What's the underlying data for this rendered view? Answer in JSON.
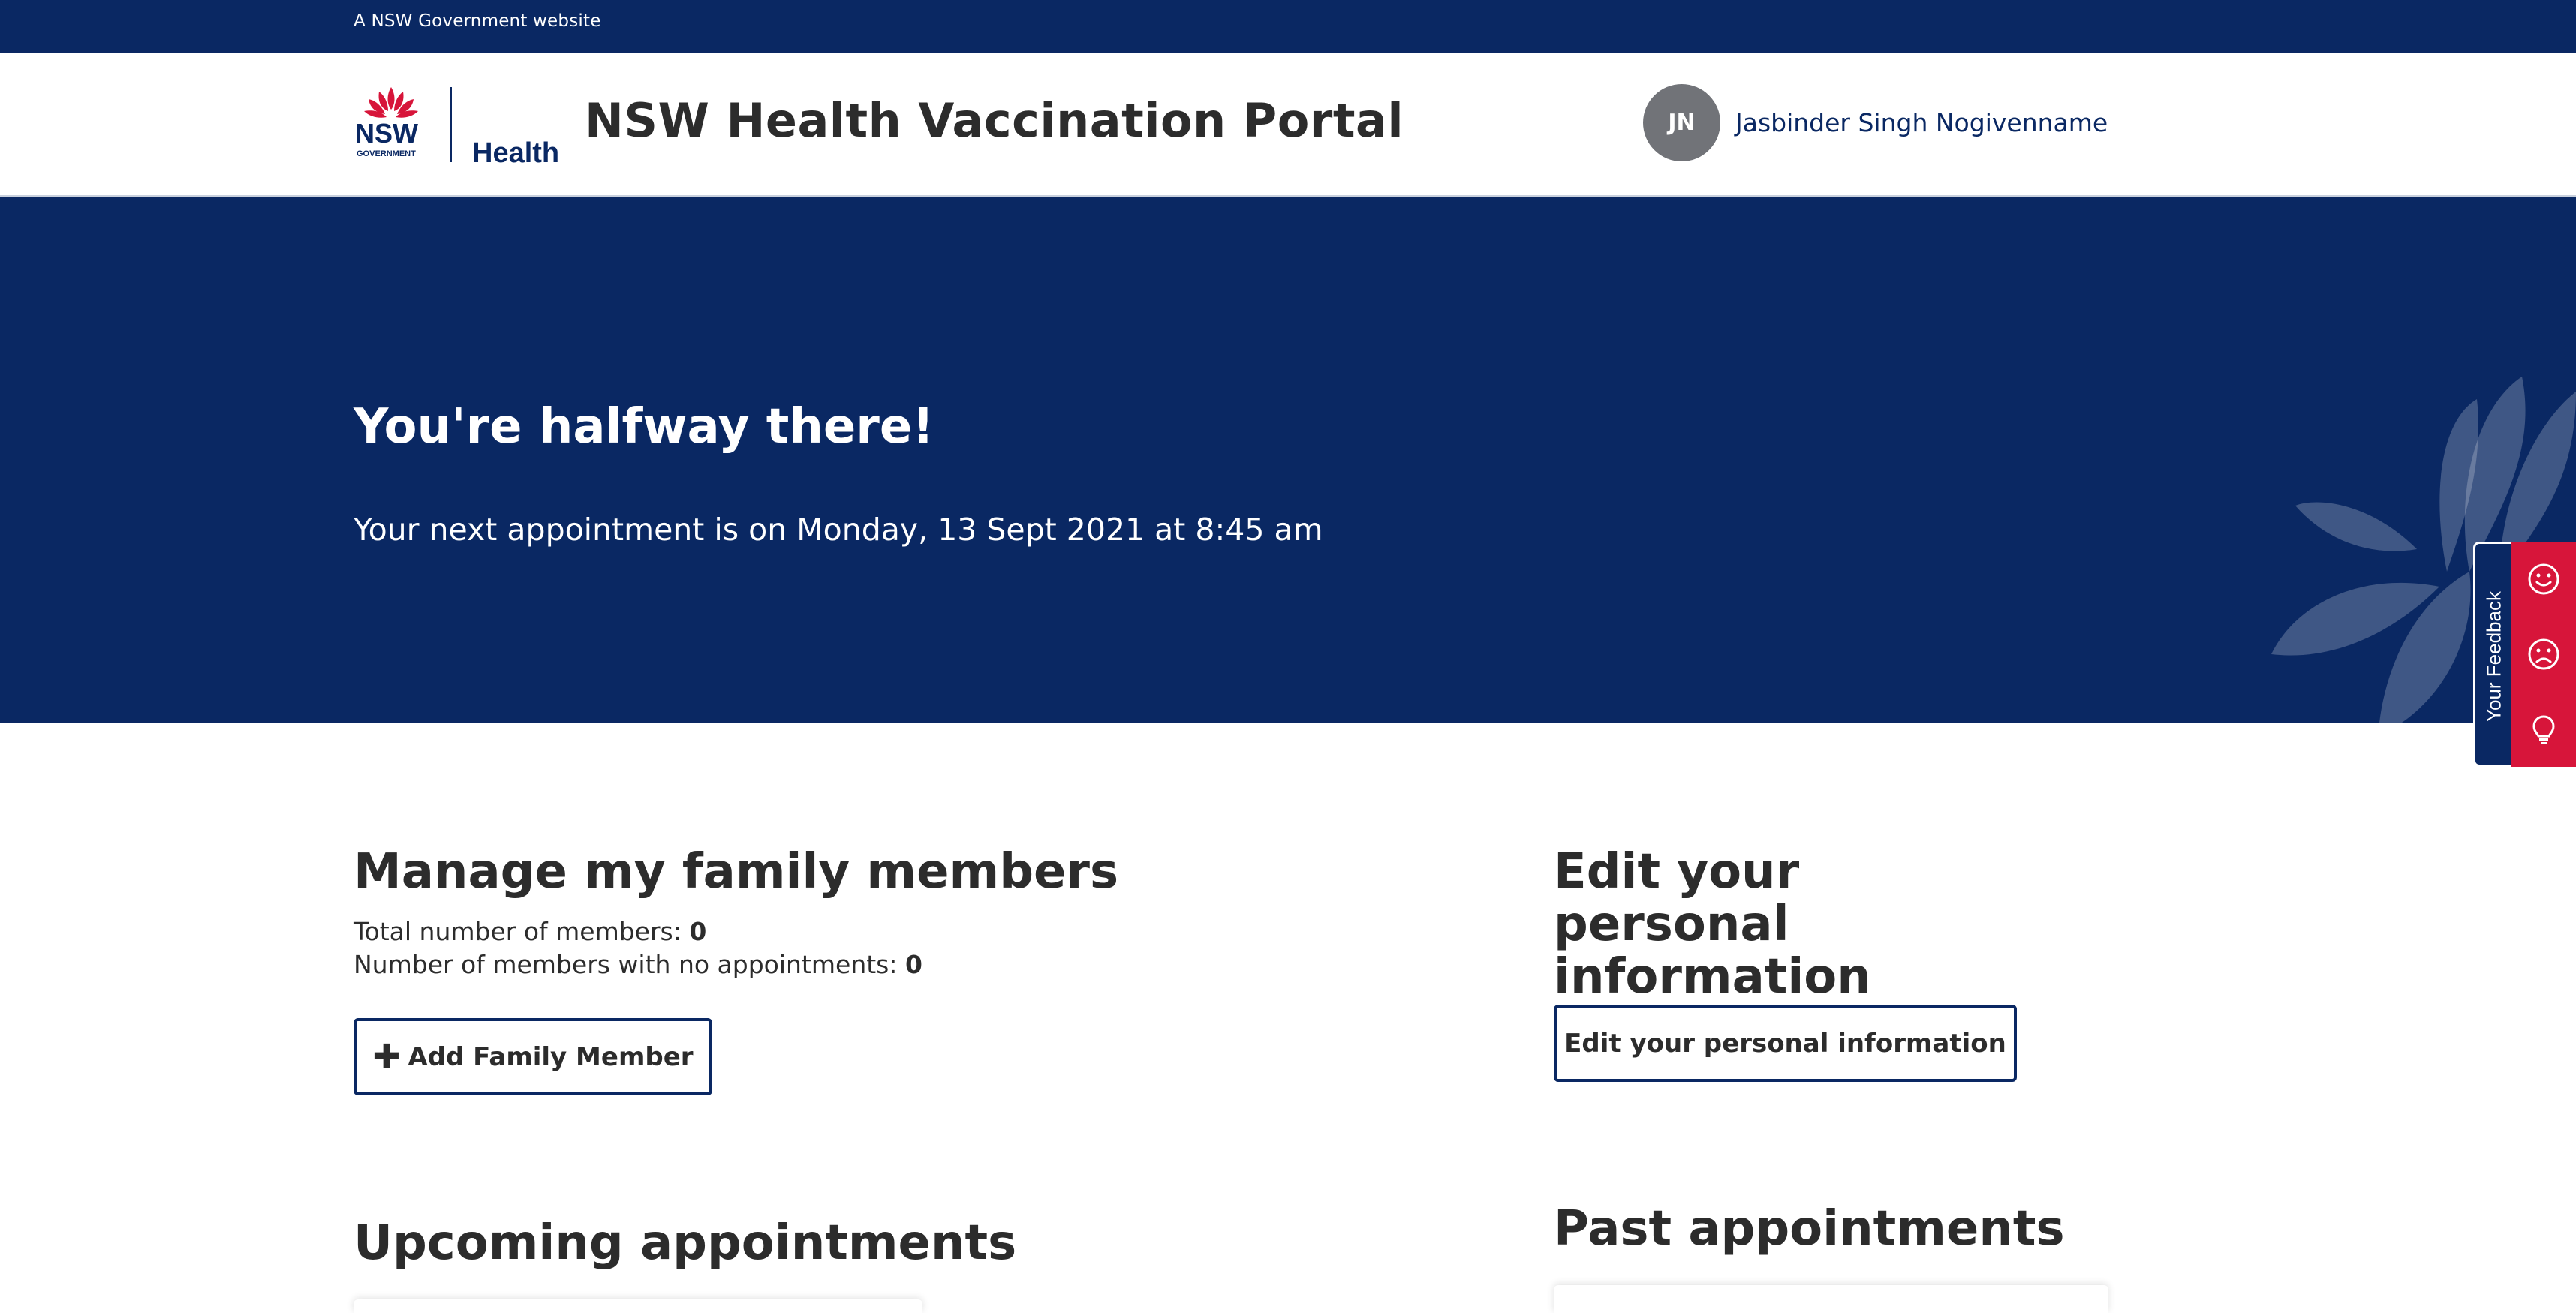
{
  "gov_bar": {
    "text": "A NSW Government website"
  },
  "header": {
    "logo_text": {
      "nsw": "NSW",
      "government": "GOVERNMENT",
      "health": "Health"
    },
    "title": "NSW Health Vaccination Portal",
    "user": {
      "initials": "JN",
      "name": "Jasbinder Singh Nogivenname"
    }
  },
  "hero": {
    "title": "You're halfway there!",
    "subtitle": "Your next appointment is on Monday, 13 Sept 2021 at 8:45 am"
  },
  "feedback": {
    "label": "Your Feedback",
    "icons": [
      "smile-icon",
      "frown-icon",
      "lightbulb-icon"
    ]
  },
  "family": {
    "heading": "Manage my family members",
    "total_label": "Total number of members:",
    "total_value": "0",
    "no_appt_label": "Number of members with no appointments:",
    "no_appt_value": "0",
    "add_button": "Add Family Member"
  },
  "personal": {
    "heading": "Edit your personal information",
    "edit_button": "Edit your personal information"
  },
  "upcoming": {
    "heading": "Upcoming appointments"
  },
  "past": {
    "heading": "Past appointments"
  },
  "colors": {
    "navy": "#0a2863",
    "red": "#d7153a",
    "avatar_grey": "#717378",
    "text": "#2c2c2c"
  }
}
